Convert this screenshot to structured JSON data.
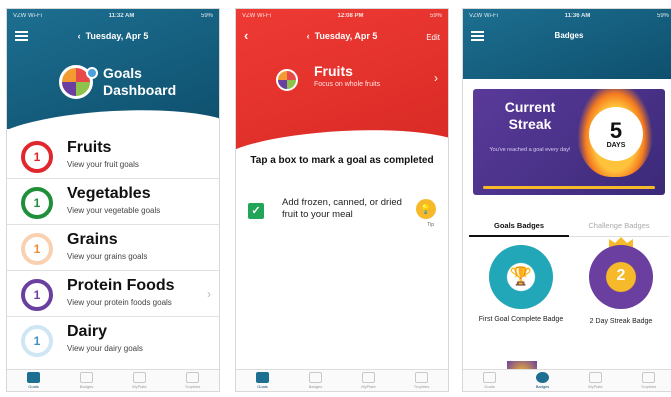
{
  "phone1": {
    "status": {
      "carrier": "VZW Wi-Fi",
      "time": "11:32 AM",
      "battery": "59%"
    },
    "date": "Tuesday, Apr 5",
    "title_line1": "Goals",
    "title_line2": "Dashboard",
    "goals": [
      {
        "count": "1",
        "name": "Fruits",
        "sub": "View your fruit goals",
        "color": "#e0272d"
      },
      {
        "count": "1",
        "name": "Vegetables",
        "sub": "View your vegetable goals",
        "color": "#1f8f3a"
      },
      {
        "count": "1",
        "name": "Grains",
        "sub": "View your grains goals",
        "color": "#f5a86a"
      },
      {
        "count": "1",
        "name": "Protein Foods",
        "sub": "View your protein foods goals",
        "color": "#6a3fa0"
      },
      {
        "count": "1",
        "name": "Dairy",
        "sub": "View your dairy goals",
        "color": "#8ec3e6"
      }
    ],
    "tabs": [
      "Goals",
      "Badges",
      "MyPlate",
      "Trophies"
    ]
  },
  "phone2": {
    "status": {
      "carrier": "VZW Wi-Fi",
      "time": "12:08 PM",
      "battery": "59%"
    },
    "date": "Tuesday, Apr 5",
    "edit": "Edit",
    "title": "Fruits",
    "subtitle": "Focus on whole fruits",
    "instruction": "Tap a box to mark a goal as completed",
    "goal_text": "Add frozen, canned, or dried fruit to your meal",
    "goal_checked": true,
    "tip_label": "Tip",
    "tabs": [
      "Goals",
      "Badges",
      "MyPlate",
      "Trophies"
    ]
  },
  "phone3": {
    "status": {
      "carrier": "VZW Wi-Fi",
      "time": "11:36 AM",
      "battery": "59%"
    },
    "title": "Badges",
    "streak_title": "Current Streak",
    "streak_sub": "You've reached a goal every day!",
    "streak_count": "5",
    "streak_unit": "DAYS",
    "tab_goals": "Goals Badges",
    "tab_challenge": "Challenge Badges",
    "badge1_label": "First Goal Complete Badge",
    "badge2_label": "2 Day Streak Badge",
    "badge2_num": "2",
    "tabs": [
      "Goals",
      "Badges",
      "MyPlate",
      "Trophies"
    ]
  }
}
